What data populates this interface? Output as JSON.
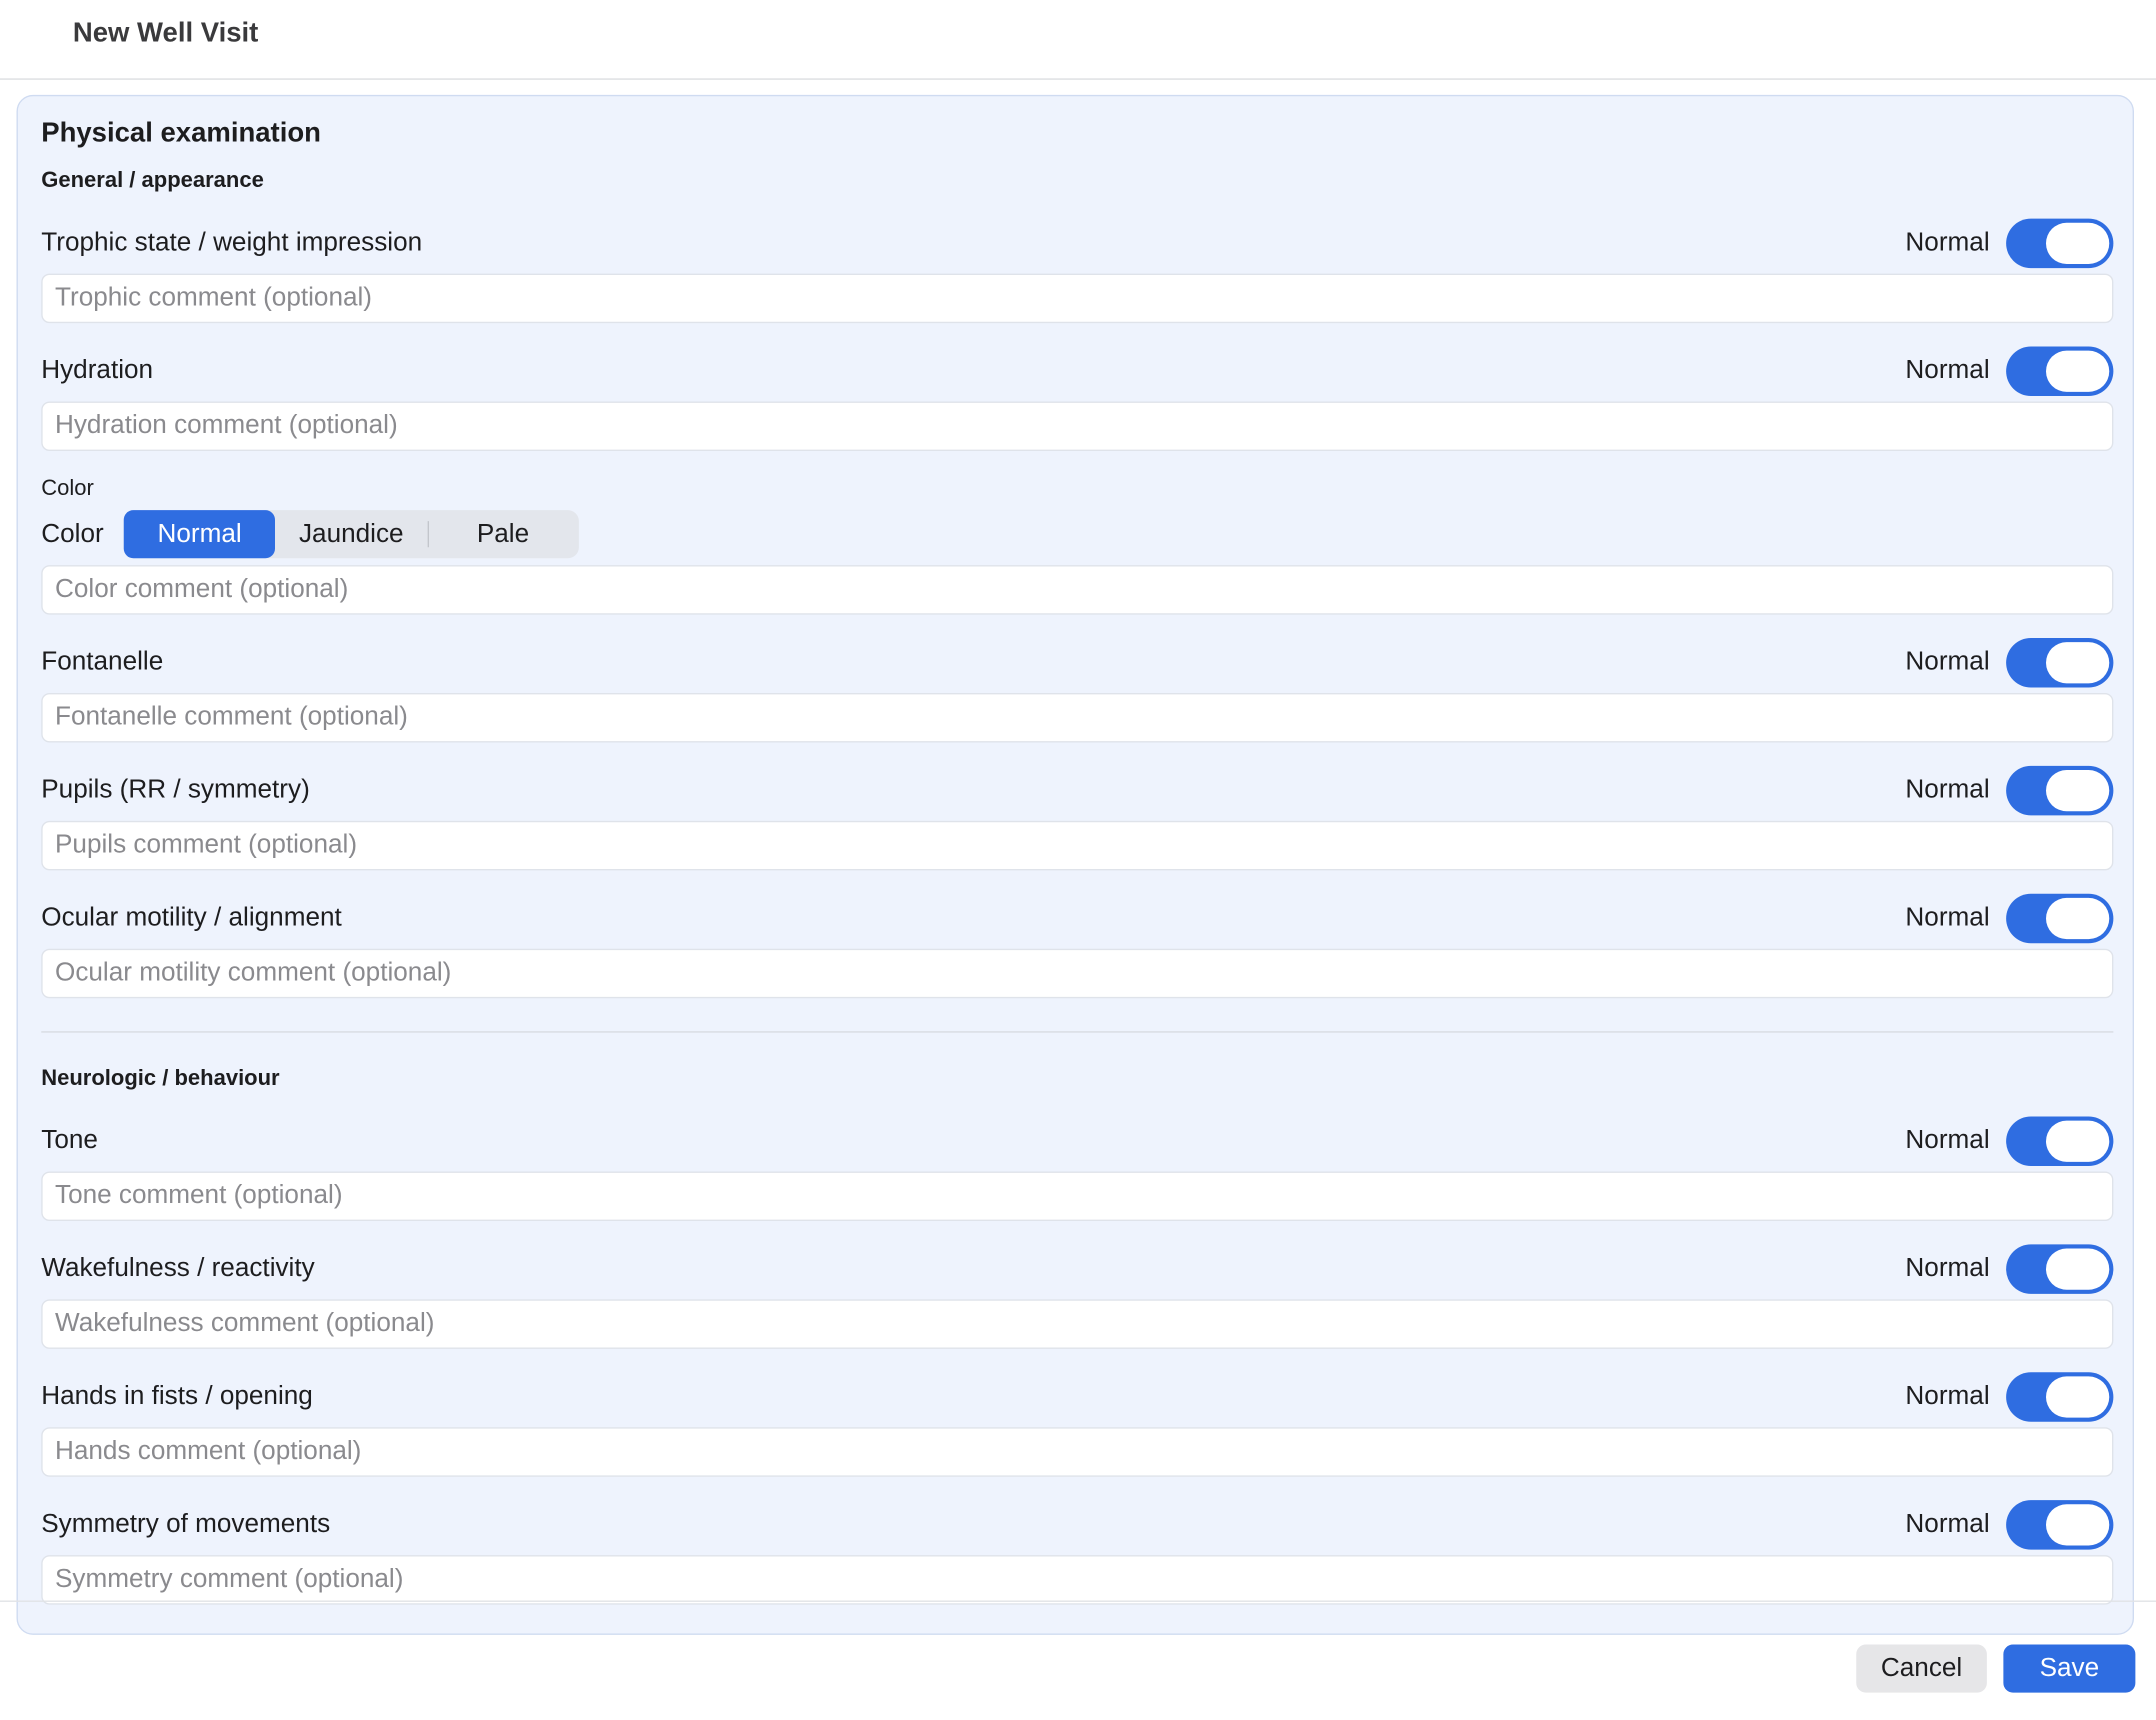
{
  "window": {
    "title": "New Well Visit"
  },
  "panel": {
    "title": "Physical examination"
  },
  "sections": {
    "general": {
      "title": "General / appearance",
      "rows": [
        {
          "label": "Trophic state / weight impression",
          "status": "Normal",
          "normal": true,
          "placeholder": "Trophic comment (optional)"
        },
        {
          "label": "Hydration",
          "status": "Normal",
          "normal": true,
          "placeholder": "Hydration comment (optional)"
        },
        {
          "label": "Fontanelle",
          "status": "Normal",
          "normal": true,
          "placeholder": "Fontanelle comment (optional)"
        },
        {
          "label": "Pupils (RR / symmetry)",
          "status": "Normal",
          "normal": true,
          "placeholder": "Pupils comment (optional)"
        },
        {
          "label": "Ocular motility / alignment",
          "status": "Normal",
          "normal": true,
          "placeholder": "Ocular motility comment (optional)"
        }
      ]
    },
    "color": {
      "caption": "Color",
      "label": "Color",
      "options": [
        "Normal",
        "Jaundice",
        "Pale"
      ],
      "selected": "Normal",
      "placeholder": "Color comment (optional)"
    },
    "neuro": {
      "title": "Neurologic / behaviour",
      "rows": [
        {
          "label": "Tone",
          "status": "Normal",
          "normal": true,
          "placeholder": "Tone comment (optional)"
        },
        {
          "label": "Wakefulness / reactivity",
          "status": "Normal",
          "normal": true,
          "placeholder": "Wakefulness comment (optional)"
        },
        {
          "label": "Hands in fists / opening",
          "status": "Normal",
          "normal": true,
          "placeholder": "Hands comment (optional)"
        },
        {
          "label": "Symmetry of movements",
          "status": "Normal",
          "normal": true,
          "placeholder": "Symmetry comment (optional)"
        }
      ]
    }
  },
  "footer": {
    "cancel_label": "Cancel",
    "save_label": "Save"
  },
  "colors": {
    "accent": "#2f6de1",
    "panel_bg": "#eef3fd"
  }
}
